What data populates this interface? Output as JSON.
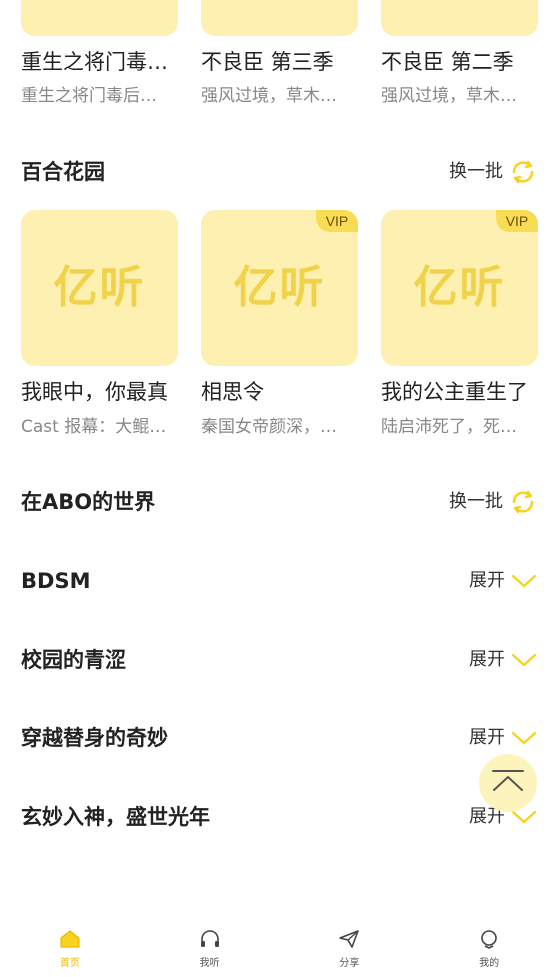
{
  "top_row": {
    "items": [
      {
        "title": "重生之将门毒…",
        "desc": "重生之将门毒后…"
      },
      {
        "title": "不良臣 第三季",
        "desc": "强风过境，草木…"
      },
      {
        "title": "不良臣 第二季",
        "desc": "强风过境，草木…"
      }
    ]
  },
  "sections": [
    {
      "title": "百合花园",
      "action": "换一批",
      "items": [
        {
          "logo": "亿听",
          "vip": "",
          "title": "我眼中，你最真",
          "desc": "Cast 报幕：大鲲…"
        },
        {
          "logo": "亿听",
          "vip": "VIP",
          "title": "相思令",
          "desc": "秦国女帝颜深，…"
        },
        {
          "logo": "亿听",
          "vip": "VIP",
          "title": "我的公主重生了",
          "desc": "陆启沛死了，死…"
        }
      ]
    },
    {
      "title": "在ABO的世界",
      "action": "换一批"
    },
    {
      "title": "BDSM",
      "action": "展开"
    },
    {
      "title": "校园的青涩",
      "action": "展开"
    },
    {
      "title": "穿越替身的奇妙",
      "action": "展开"
    },
    {
      "title": "玄妙入神，盛世光年",
      "action": "展开"
    }
  ],
  "tabbar": {
    "tabs": [
      {
        "label": "首页",
        "icon": "home-icon",
        "active": true
      },
      {
        "label": "我听",
        "icon": "headphones-icon",
        "active": false
      },
      {
        "label": "分享",
        "icon": "send-icon",
        "active": false
      },
      {
        "label": "我的",
        "icon": "user-icon",
        "active": false
      }
    ]
  },
  "colors": {
    "accent": "#f7dc54",
    "card_bg": "#fdf0b0",
    "logo": "#f1d24b",
    "active_tab": "#f2b705"
  }
}
